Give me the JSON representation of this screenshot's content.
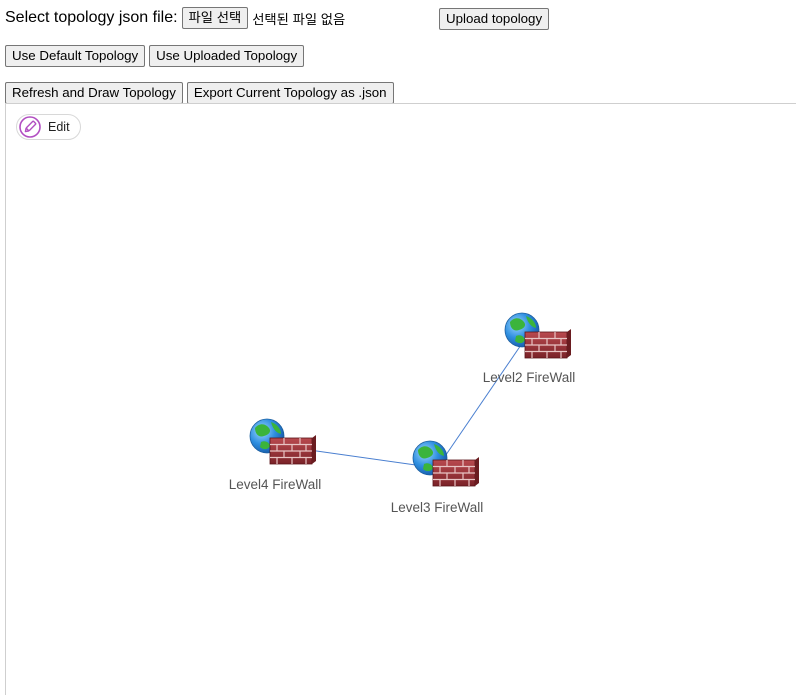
{
  "file_picker": {
    "label": "Select topology json file:",
    "choose_button": "파일 선택",
    "status": "선택된 파일 없음",
    "upload_button": "Upload topology"
  },
  "topology_source": {
    "default_button": "Use Default Topology",
    "uploaded_button": "Use Uploaded Topology"
  },
  "actions": {
    "refresh_button": "Refresh and Draw Topology",
    "export_button": "Export Current Topology as .json"
  },
  "canvas": {
    "edit_label": "Edit",
    "nodes": [
      {
        "id": "level2",
        "label": "Level2 FireWall",
        "icon": "firewall-globe-icon"
      },
      {
        "id": "level3",
        "label": "Level3 FireWall",
        "icon": "firewall-globe-icon"
      },
      {
        "id": "level4",
        "label": "Level4 FireWall",
        "icon": "firewall-globe-icon"
      }
    ],
    "links": [
      {
        "from": "level2",
        "to": "level3"
      },
      {
        "from": "level3",
        "to": "level4"
      }
    ],
    "colors": {
      "link": "#4a7fd0",
      "edit_accent": "#b24fc2",
      "label": "#555555"
    }
  }
}
